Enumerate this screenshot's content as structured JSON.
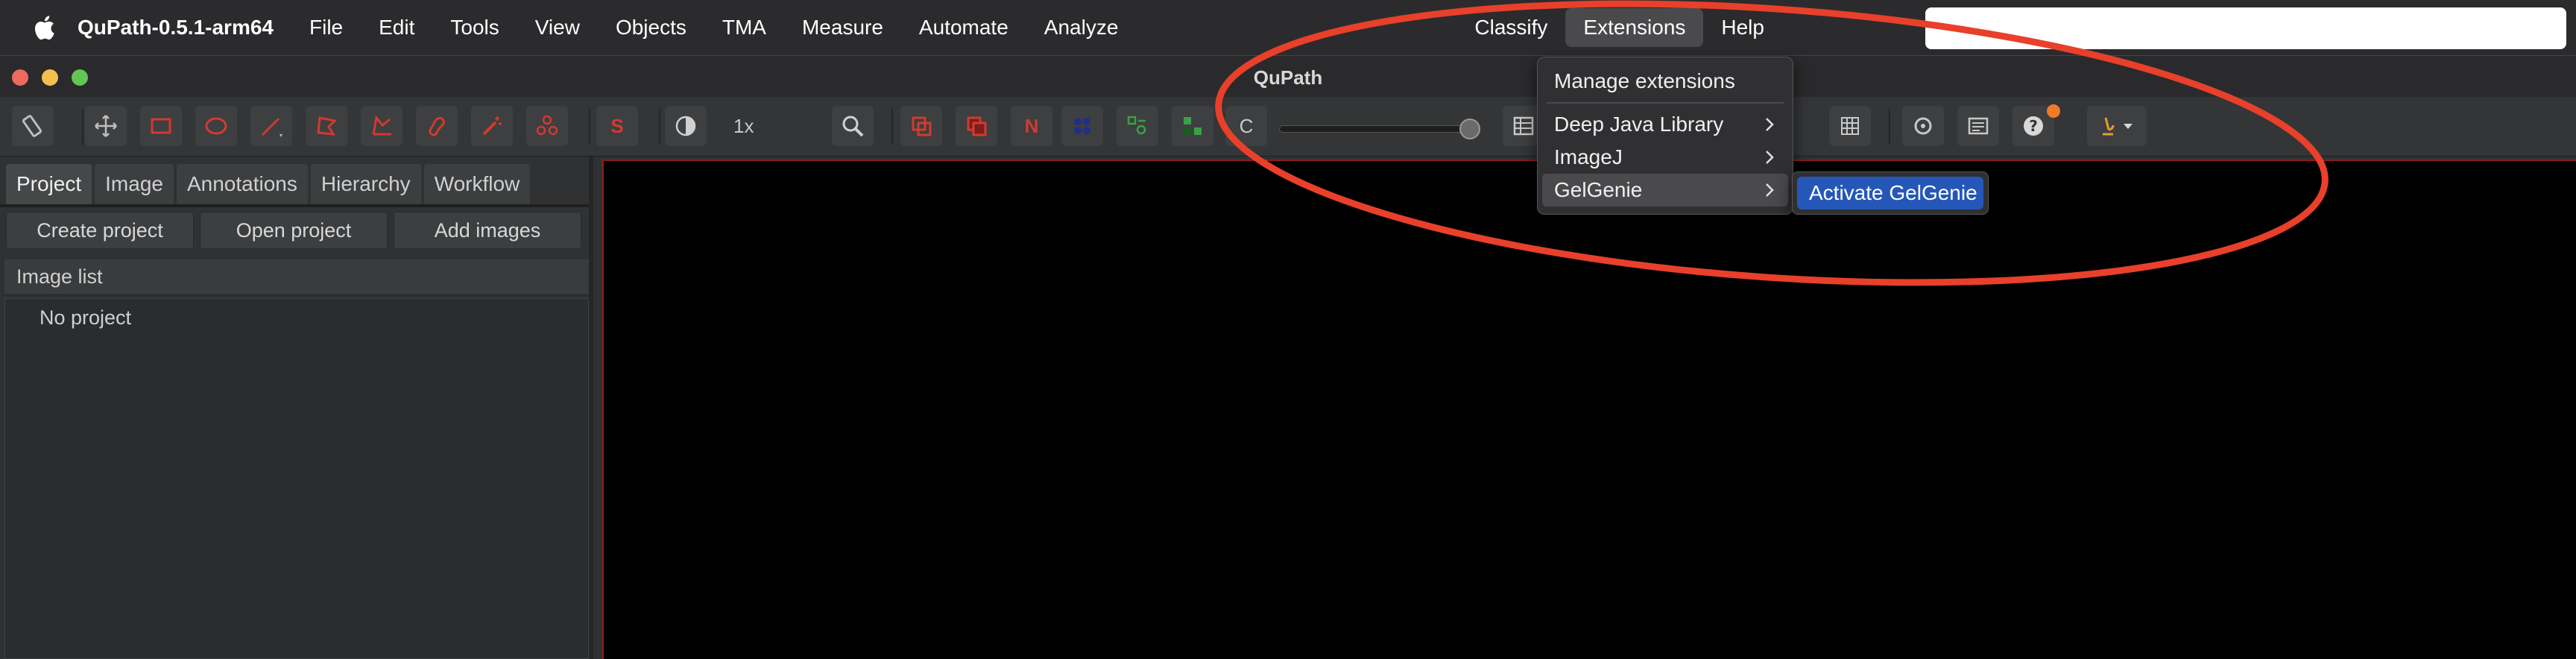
{
  "menubar": {
    "app_name": "QuPath-0.5.1-arm64",
    "items": [
      "File",
      "Edit",
      "Tools",
      "View",
      "Objects",
      "TMA",
      "Measure",
      "Automate",
      "Analyze"
    ],
    "right_items": [
      "Classify",
      "Extensions",
      "Help"
    ],
    "active_item": "Extensions"
  },
  "window": {
    "title": "QuPath"
  },
  "toolbar": {
    "zoom_label": "1x",
    "s_label": "S",
    "n_label": "N",
    "c_label": "C",
    "accent_red": "#d23a2e"
  },
  "left_panel": {
    "tabs": [
      "Project",
      "Image",
      "Annotations",
      "Hierarchy",
      "Workflow"
    ],
    "active_tab": "Project",
    "actions": [
      "Create project",
      "Open project",
      "Add images"
    ],
    "list_title": "Image list",
    "empty_text": "No project"
  },
  "extensions_menu": {
    "items": [
      {
        "label": "Manage extensions",
        "submenu": false
      },
      {
        "label": "Deep Java Library",
        "submenu": true
      },
      {
        "label": "ImageJ",
        "submenu": true
      },
      {
        "label": "GelGenie",
        "submenu": true
      }
    ],
    "hovered": "GelGenie",
    "submenu_item": "Activate GelGenie"
  },
  "colors": {
    "annotation_ellipse": "#e8402a",
    "submenu_highlight": "#2557b8"
  }
}
